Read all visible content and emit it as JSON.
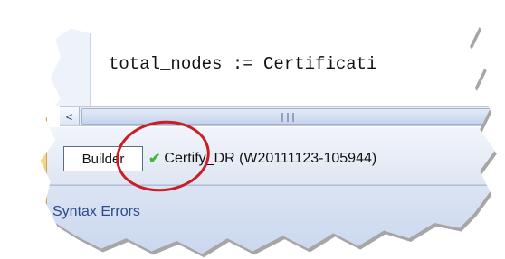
{
  "code": {
    "line": "total_nodes := Certificati"
  },
  "scrollbar": {
    "left_arrow": "<",
    "thumb_grip": "III"
  },
  "statusbar": {
    "builder_label": "Builder",
    "status_text": "Certify_DR (W20111123-105944)",
    "status_icon": "check-icon"
  },
  "errors_panel": {
    "title": "Syntax Errors"
  },
  "colors": {
    "highlight": "#c81e24",
    "check": "#42b83e",
    "panel_title": "#2c4a8a"
  }
}
